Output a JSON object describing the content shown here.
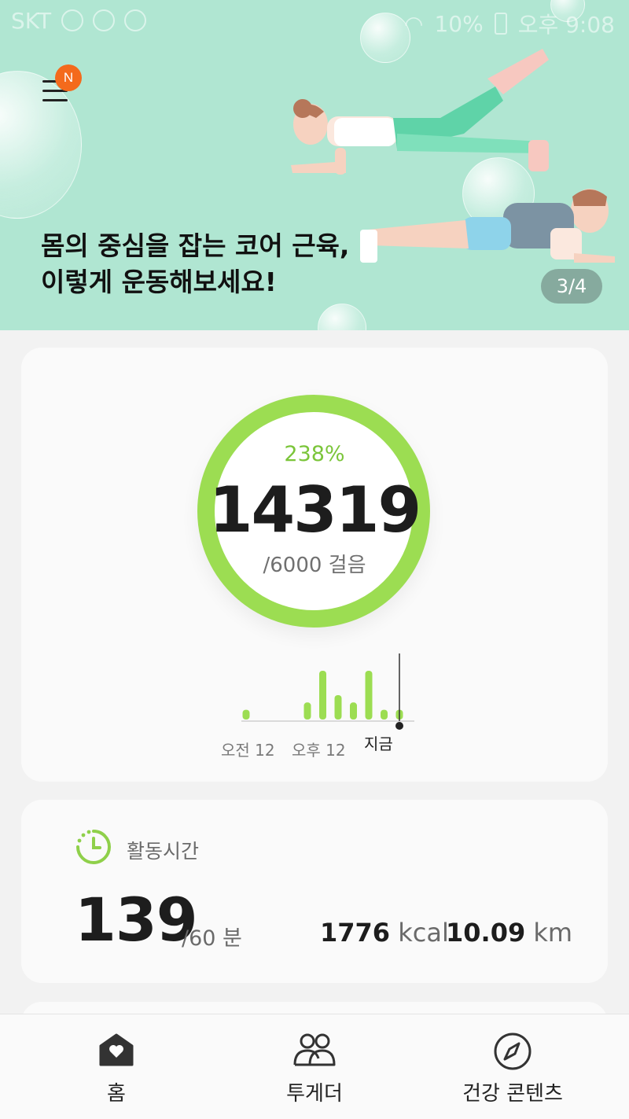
{
  "status_bar": {
    "carrier": "SKT",
    "battery": "10%",
    "time": "오후 9:08"
  },
  "banner": {
    "title": "몸의 중심을 잡는 코어 근육,\n이렇게 운동해보세요!",
    "page_indicator": "3/4",
    "menu_badge": "N",
    "background_color": "#b0e6d2"
  },
  "steps": {
    "percent": "238%",
    "count": "14319",
    "goal": "/6000 걸음",
    "progress_fraction": 1.0,
    "ring_color": "#9cdd52",
    "chart": {
      "bars": [
        0.2,
        0,
        0,
        0,
        0.35,
        1.0,
        0.5,
        0.35,
        1.0,
        0.2,
        0.2
      ],
      "labels": [
        "오전 12",
        "오후 12",
        "지금"
      ]
    }
  },
  "activity": {
    "title": "활동시간",
    "minutes": "139",
    "goal": "/60 분",
    "kcal_value": "1776",
    "kcal_unit": "kcal",
    "km_value": "10.09",
    "km_unit": "km"
  },
  "nav": {
    "home": "홈",
    "together": "투게더",
    "content": "건강 콘텐츠"
  }
}
